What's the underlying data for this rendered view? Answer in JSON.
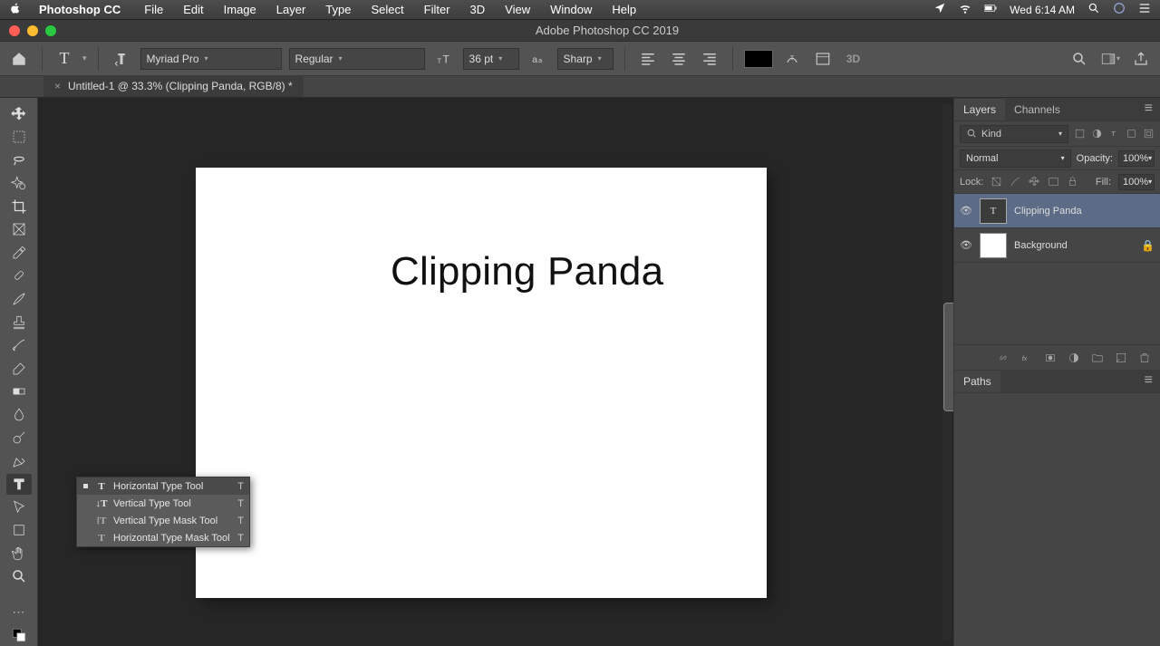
{
  "menubar": {
    "app": "Photoshop CC",
    "items": [
      "File",
      "Edit",
      "Image",
      "Layer",
      "Type",
      "Select",
      "Filter",
      "3D",
      "View",
      "Window",
      "Help"
    ],
    "clock": "Wed 6:14 AM"
  },
  "window": {
    "title": "Adobe Photoshop CC 2019"
  },
  "options": {
    "font_family": "Myriad Pro",
    "font_style": "Regular",
    "font_size": "36 pt",
    "antialias": "Sharp"
  },
  "document": {
    "tab": "Untitled-1 @ 33.3% (Clipping Panda, RGB/8) *"
  },
  "canvas": {
    "text": "Clipping Panda"
  },
  "flyout": {
    "items": [
      {
        "label": "Horizontal Type Tool",
        "shortcut": "T",
        "selected": true
      },
      {
        "label": "Vertical Type Tool",
        "shortcut": "T",
        "selected": false
      },
      {
        "label": "Vertical Type Mask Tool",
        "shortcut": "T",
        "selected": false
      },
      {
        "label": "Horizontal Type Mask Tool",
        "shortcut": "T",
        "selected": false
      }
    ]
  },
  "panels": {
    "layers_tab": "Layers",
    "channels_tab": "Channels",
    "paths_tab": "Paths",
    "kind": "Kind",
    "blend": "Normal",
    "opacity_lbl": "Opacity:",
    "opacity": "100%",
    "lock_lbl": "Lock:",
    "fill_lbl": "Fill:",
    "fill": "100%",
    "layers": [
      {
        "name": "Clipping Panda",
        "type": "text",
        "selected": true,
        "locked": false
      },
      {
        "name": "Background",
        "type": "raster",
        "selected": false,
        "locked": true
      }
    ]
  }
}
